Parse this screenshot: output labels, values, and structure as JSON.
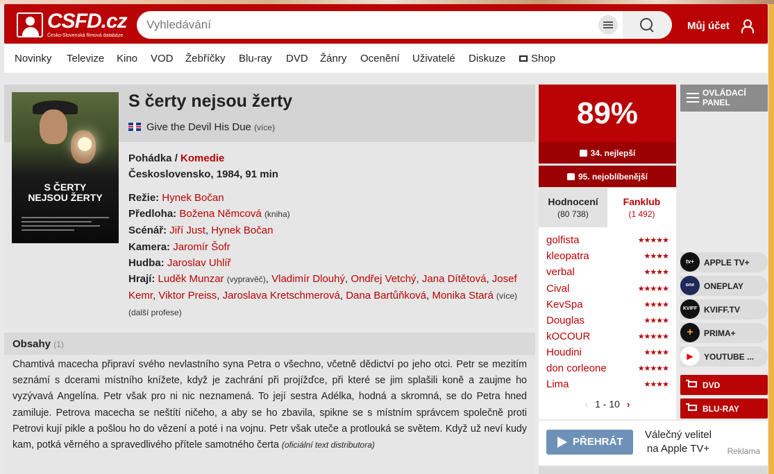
{
  "header": {
    "logo_text": "CSFD.cz",
    "logo_sub": "Česko-Slovenská filmová databáze",
    "search_placeholder": "Vyhledávání",
    "account_label": "Můj účet"
  },
  "nav": [
    "Novinky",
    "Televize",
    "Kino",
    "VOD",
    "Žebříčky",
    "Blu-ray",
    "DVD",
    "Žánry",
    "Ocenění",
    "Uživatelé",
    "Diskuze",
    "Shop"
  ],
  "movie": {
    "title": "S čerty nejsou žerty",
    "alt_title": "Give the Devil His Due",
    "more": "(více)",
    "genre1": "Pohádka",
    "genre_sep": " / ",
    "genre2": "Komedie",
    "origin": "Československo, 1984, 91 min",
    "poster_title_1": "S ČERTY",
    "poster_title_2": "NEJSOU ŽERTY",
    "director_label": "Režie:",
    "director": "Hynek Bočan",
    "source_label": "Předloha:",
    "source": "Božena Němcová",
    "source_type": "(kniha)",
    "writer_label": "Scénář:",
    "writer1": "Jiří Just",
    "writer2": "Hynek Bočan",
    "camera_label": "Kamera:",
    "camera": "Jaromír Šofr",
    "music_label": "Hudba:",
    "music": "Jaroslav Uhlíř",
    "cast_label": "Hrají:",
    "cast": [
      "Luděk Munzar",
      "Vladimír Dlouhý",
      "Ondřej Vetchý",
      "Jana Dítětová",
      "Josef Kemr",
      "Viktor Preiss",
      "Jaroslava Kretschmerová",
      "Dana Bartůňková",
      "Monika Stará"
    ],
    "narrator": "(vypravěč)",
    "cast_more": "(více)",
    "more_professions": "(další profese)"
  },
  "plot": {
    "title": "Obsahy",
    "count": "(1)",
    "text": "Chamtivá macecha připraví svého nevlastního syna Petra o všechno, včetně dědictví po jeho otci. Petr se mezitím seznámí s dcerami místního knížete, když je zachrání při projížďce, při které se jim splašili koně a zaujme ho vyzývavá Angelína. Petr však pro ni nic neznamená. To její sestra Adélka, hodná a skromná, se do Petra hned zamiluje. Petrova macecha se neštítí ničeho, a aby se ho zbavila, spikne se s místním správcem společně proti Petrovi kují pikle a pošlou ho do vězení a poté i na vojnu. Petr však uteče a protlouká se světem. Když už neví kudy kam, potká věrného a spravedlivého přítele samotného čerta",
    "source": "(oficiální text distributora)"
  },
  "rating": {
    "value": "89%",
    "rank_best": "34. nejlepší",
    "rank_popular": "95. nejoblíbenější",
    "tab_ratings": "Hodnocení",
    "tab_ratings_count": "(80 738)",
    "tab_fanclub": "Fanklub",
    "tab_fanclub_count": "(1 492)",
    "users": [
      {
        "name": "golfista",
        "stars": "★★★★★"
      },
      {
        "name": "kleopatra",
        "stars": "★★★★"
      },
      {
        "name": "verbal",
        "stars": "★★★★"
      },
      {
        "name": "Cival",
        "stars": "★★★★★"
      },
      {
        "name": "KevSpa",
        "stars": "★★★★"
      },
      {
        "name": "Douglas",
        "stars": "★★★★"
      },
      {
        "name": "kOCOUR",
        "stars": "★★★★★"
      },
      {
        "name": "Houdini",
        "stars": "★★★★"
      },
      {
        "name": "don corleone",
        "stars": "★★★★★"
      },
      {
        "name": "Lima",
        "stars": "★★★★"
      }
    ],
    "pager": "1 - 10"
  },
  "sidebar": {
    "panel_label": "OVLÁDACÍ PANEL",
    "vod": [
      {
        "label": "APPLE TV+",
        "icon": "tv+"
      },
      {
        "label": "ONEPLAY",
        "icon": "one play"
      },
      {
        "label": "KVIFF.TV",
        "icon": "KVIFF"
      },
      {
        "label": "PRIMA+",
        "icon": "+"
      },
      {
        "label": "YOUTUBE ...",
        "icon": "▶"
      }
    ],
    "buy": [
      "DVD",
      "BLU-RAY"
    ]
  },
  "ad": {
    "play_label": "PŘEHRÁT",
    "text": "Válečný velitel na Apple TV+",
    "label": "Reklama"
  },
  "colors": {
    "brand": "#ba0305",
    "dark_red": "#9b0003",
    "play_button": "#6e91b8"
  }
}
